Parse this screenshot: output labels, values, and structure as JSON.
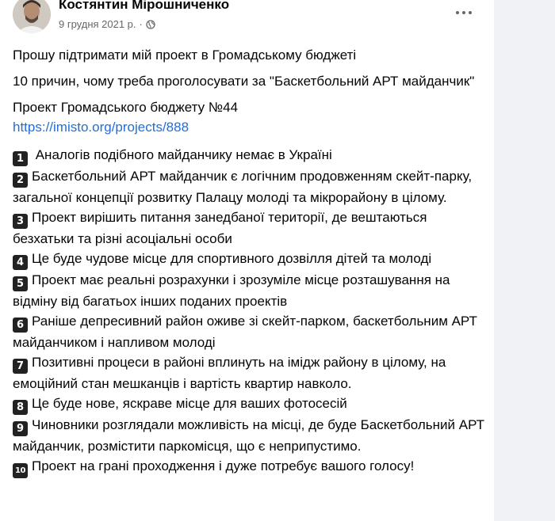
{
  "post": {
    "author": "Костянтин Мірошниченко",
    "date": "9 грудня 2021 р.",
    "dot": "·",
    "audience_icon": "globe-icon",
    "more_icon": "more-horizontal-icon",
    "title": "Прошу підтримати мій проект в Громадському бюджеті",
    "subtitle": "10 причин, чому треба проголосувати за \"Баскетбольний АРТ майданчик\"",
    "project_label": "Проект Громадського бюджету №44",
    "project_link": "https://imisto.org/projects/888",
    "reasons": [
      {
        "num": "1",
        "text": " Аналогів подібного майданчику немає в Україні"
      },
      {
        "num": "2",
        "text": "Баскетбольний АРТ майданчик є логічним продовженням скейт-парку, загальної концепції розвитку Палацу молоді та мікрорайону в цілому."
      },
      {
        "num": "3",
        "text": "Проект вирішить питання занедбаної території, де вештаються безхатьки та різні асоціальні особи"
      },
      {
        "num": "4",
        "text": "Це буде чудове місце для спортивного дозвілля дітей та молоді"
      },
      {
        "num": "5",
        "text": "Проект має реальні розрахунки і зрозуміле місце розташування на відміну від багатьох інших поданих проектів"
      },
      {
        "num": "6",
        "text": "Раніше депресивний район оживе зі скейт-парком, баскетбольним АРТ майданчиком і напливом молоді"
      },
      {
        "num": "7",
        "text": "Позитивні процеси в районі вплинуть на імідж району в цілому, на емоційний стан мешканців і вартість квартир навколо."
      },
      {
        "num": "8",
        "text": "Це буде нове, яскраве місце для ваших фотосесій"
      },
      {
        "num": "9",
        "text": "Чиновники розглядали можливість на місці, де буде Баскетбольний АРТ майданчик, розмістити паркомісця, що є неприпустимо."
      },
      {
        "num": "10",
        "text": "Проект на грані проходження і дуже потребує вашого голосу!"
      }
    ]
  },
  "colors": {
    "link": "#216fdb",
    "meta": "#65676b",
    "background": "#f0f2f5"
  }
}
